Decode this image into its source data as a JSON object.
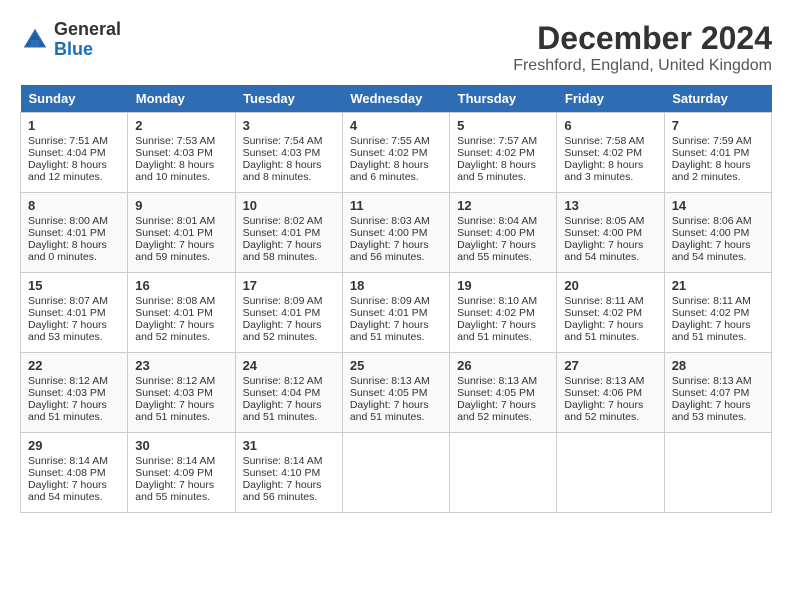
{
  "header": {
    "logo_general": "General",
    "logo_blue": "Blue",
    "month_title": "December 2024",
    "location": "Freshford, England, United Kingdom"
  },
  "days_of_week": [
    "Sunday",
    "Monday",
    "Tuesday",
    "Wednesday",
    "Thursday",
    "Friday",
    "Saturday"
  ],
  "weeks": [
    [
      {
        "day": 1,
        "sunrise": "Sunrise: 7:51 AM",
        "sunset": "Sunset: 4:04 PM",
        "daylight": "Daylight: 8 hours and 12 minutes."
      },
      {
        "day": 2,
        "sunrise": "Sunrise: 7:53 AM",
        "sunset": "Sunset: 4:03 PM",
        "daylight": "Daylight: 8 hours and 10 minutes."
      },
      {
        "day": 3,
        "sunrise": "Sunrise: 7:54 AM",
        "sunset": "Sunset: 4:03 PM",
        "daylight": "Daylight: 8 hours and 8 minutes."
      },
      {
        "day": 4,
        "sunrise": "Sunrise: 7:55 AM",
        "sunset": "Sunset: 4:02 PM",
        "daylight": "Daylight: 8 hours and 6 minutes."
      },
      {
        "day": 5,
        "sunrise": "Sunrise: 7:57 AM",
        "sunset": "Sunset: 4:02 PM",
        "daylight": "Daylight: 8 hours and 5 minutes."
      },
      {
        "day": 6,
        "sunrise": "Sunrise: 7:58 AM",
        "sunset": "Sunset: 4:02 PM",
        "daylight": "Daylight: 8 hours and 3 minutes."
      },
      {
        "day": 7,
        "sunrise": "Sunrise: 7:59 AM",
        "sunset": "Sunset: 4:01 PM",
        "daylight": "Daylight: 8 hours and 2 minutes."
      }
    ],
    [
      {
        "day": 8,
        "sunrise": "Sunrise: 8:00 AM",
        "sunset": "Sunset: 4:01 PM",
        "daylight": "Daylight: 8 hours and 0 minutes."
      },
      {
        "day": 9,
        "sunrise": "Sunrise: 8:01 AM",
        "sunset": "Sunset: 4:01 PM",
        "daylight": "Daylight: 7 hours and 59 minutes."
      },
      {
        "day": 10,
        "sunrise": "Sunrise: 8:02 AM",
        "sunset": "Sunset: 4:01 PM",
        "daylight": "Daylight: 7 hours and 58 minutes."
      },
      {
        "day": 11,
        "sunrise": "Sunrise: 8:03 AM",
        "sunset": "Sunset: 4:00 PM",
        "daylight": "Daylight: 7 hours and 56 minutes."
      },
      {
        "day": 12,
        "sunrise": "Sunrise: 8:04 AM",
        "sunset": "Sunset: 4:00 PM",
        "daylight": "Daylight: 7 hours and 55 minutes."
      },
      {
        "day": 13,
        "sunrise": "Sunrise: 8:05 AM",
        "sunset": "Sunset: 4:00 PM",
        "daylight": "Daylight: 7 hours and 54 minutes."
      },
      {
        "day": 14,
        "sunrise": "Sunrise: 8:06 AM",
        "sunset": "Sunset: 4:00 PM",
        "daylight": "Daylight: 7 hours and 54 minutes."
      }
    ],
    [
      {
        "day": 15,
        "sunrise": "Sunrise: 8:07 AM",
        "sunset": "Sunset: 4:01 PM",
        "daylight": "Daylight: 7 hours and 53 minutes."
      },
      {
        "day": 16,
        "sunrise": "Sunrise: 8:08 AM",
        "sunset": "Sunset: 4:01 PM",
        "daylight": "Daylight: 7 hours and 52 minutes."
      },
      {
        "day": 17,
        "sunrise": "Sunrise: 8:09 AM",
        "sunset": "Sunset: 4:01 PM",
        "daylight": "Daylight: 7 hours and 52 minutes."
      },
      {
        "day": 18,
        "sunrise": "Sunrise: 8:09 AM",
        "sunset": "Sunset: 4:01 PM",
        "daylight": "Daylight: 7 hours and 51 minutes."
      },
      {
        "day": 19,
        "sunrise": "Sunrise: 8:10 AM",
        "sunset": "Sunset: 4:02 PM",
        "daylight": "Daylight: 7 hours and 51 minutes."
      },
      {
        "day": 20,
        "sunrise": "Sunrise: 8:11 AM",
        "sunset": "Sunset: 4:02 PM",
        "daylight": "Daylight: 7 hours and 51 minutes."
      },
      {
        "day": 21,
        "sunrise": "Sunrise: 8:11 AM",
        "sunset": "Sunset: 4:02 PM",
        "daylight": "Daylight: 7 hours and 51 minutes."
      }
    ],
    [
      {
        "day": 22,
        "sunrise": "Sunrise: 8:12 AM",
        "sunset": "Sunset: 4:03 PM",
        "daylight": "Daylight: 7 hours and 51 minutes."
      },
      {
        "day": 23,
        "sunrise": "Sunrise: 8:12 AM",
        "sunset": "Sunset: 4:03 PM",
        "daylight": "Daylight: 7 hours and 51 minutes."
      },
      {
        "day": 24,
        "sunrise": "Sunrise: 8:12 AM",
        "sunset": "Sunset: 4:04 PM",
        "daylight": "Daylight: 7 hours and 51 minutes."
      },
      {
        "day": 25,
        "sunrise": "Sunrise: 8:13 AM",
        "sunset": "Sunset: 4:05 PM",
        "daylight": "Daylight: 7 hours and 51 minutes."
      },
      {
        "day": 26,
        "sunrise": "Sunrise: 8:13 AM",
        "sunset": "Sunset: 4:05 PM",
        "daylight": "Daylight: 7 hours and 52 minutes."
      },
      {
        "day": 27,
        "sunrise": "Sunrise: 8:13 AM",
        "sunset": "Sunset: 4:06 PM",
        "daylight": "Daylight: 7 hours and 52 minutes."
      },
      {
        "day": 28,
        "sunrise": "Sunrise: 8:13 AM",
        "sunset": "Sunset: 4:07 PM",
        "daylight": "Daylight: 7 hours and 53 minutes."
      }
    ],
    [
      {
        "day": 29,
        "sunrise": "Sunrise: 8:14 AM",
        "sunset": "Sunset: 4:08 PM",
        "daylight": "Daylight: 7 hours and 54 minutes."
      },
      {
        "day": 30,
        "sunrise": "Sunrise: 8:14 AM",
        "sunset": "Sunset: 4:09 PM",
        "daylight": "Daylight: 7 hours and 55 minutes."
      },
      {
        "day": 31,
        "sunrise": "Sunrise: 8:14 AM",
        "sunset": "Sunset: 4:10 PM",
        "daylight": "Daylight: 7 hours and 56 minutes."
      },
      null,
      null,
      null,
      null
    ]
  ]
}
